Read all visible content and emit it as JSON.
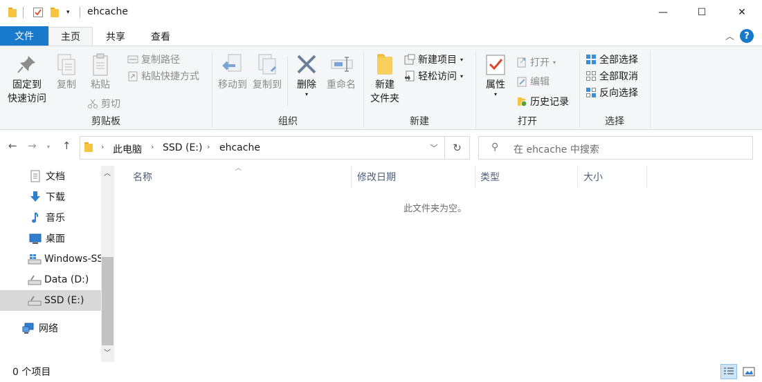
{
  "window": {
    "title": "ehcache",
    "controls": {
      "minimize": "—",
      "maximize": "☐",
      "close": "✕"
    }
  },
  "ribbon": {
    "tabs": [
      {
        "label": "文件"
      },
      {
        "label": "主页"
      },
      {
        "label": "共享"
      },
      {
        "label": "查看"
      }
    ],
    "clipboard": {
      "group_label": "剪贴板",
      "pin_line1": "固定到",
      "pin_line2": "快速访问",
      "copy": "复制",
      "paste": "粘贴",
      "copy_path": "复制路径",
      "paste_shortcut": "粘贴快捷方式",
      "cut": "剪切"
    },
    "organize": {
      "group_label": "组织",
      "move_to": "移动到",
      "copy_to": "复制到",
      "delete": "删除",
      "rename": "重命名"
    },
    "new": {
      "group_label": "新建",
      "new_folder_line1": "新建",
      "new_folder_line2": "文件夹",
      "new_item": "新建项目",
      "easy_access": "轻松访问"
    },
    "open": {
      "group_label": "打开",
      "properties": "属性",
      "open": "打开",
      "edit": "编辑",
      "history": "历史记录"
    },
    "select": {
      "group_label": "选择",
      "select_all": "全部选择",
      "select_none": "全部取消",
      "invert": "反向选择"
    }
  },
  "address": {
    "crumbs": [
      "此电脑",
      "SSD (E:)",
      "ehcache"
    ],
    "search_placeholder": "在 ehcache 中搜索"
  },
  "nav_pane": {
    "items": [
      {
        "label": "文档",
        "icon": "documents-icon"
      },
      {
        "label": "下载",
        "icon": "downloads-icon"
      },
      {
        "label": "音乐",
        "icon": "music-icon"
      },
      {
        "label": "桌面",
        "icon": "desktop-icon"
      },
      {
        "label": "Windows-SSD (C:)",
        "icon": "windows-drive-icon"
      },
      {
        "label": "Data (D:)",
        "icon": "drive-icon"
      },
      {
        "label": "SSD (E:)",
        "icon": "drive-icon",
        "selected": true
      },
      {
        "label": "网络",
        "icon": "network-icon"
      }
    ]
  },
  "content": {
    "columns": [
      "名称",
      "修改日期",
      "类型",
      "大小"
    ],
    "empty_message": "此文件夹为空。"
  },
  "status": {
    "item_count": "0 个项目"
  },
  "colors": {
    "file_tab": "#1979ca",
    "ribbon_bg": "#f5f6f7",
    "selected_nav": "#d9d9d9",
    "column_header_text": "#4c607a"
  }
}
